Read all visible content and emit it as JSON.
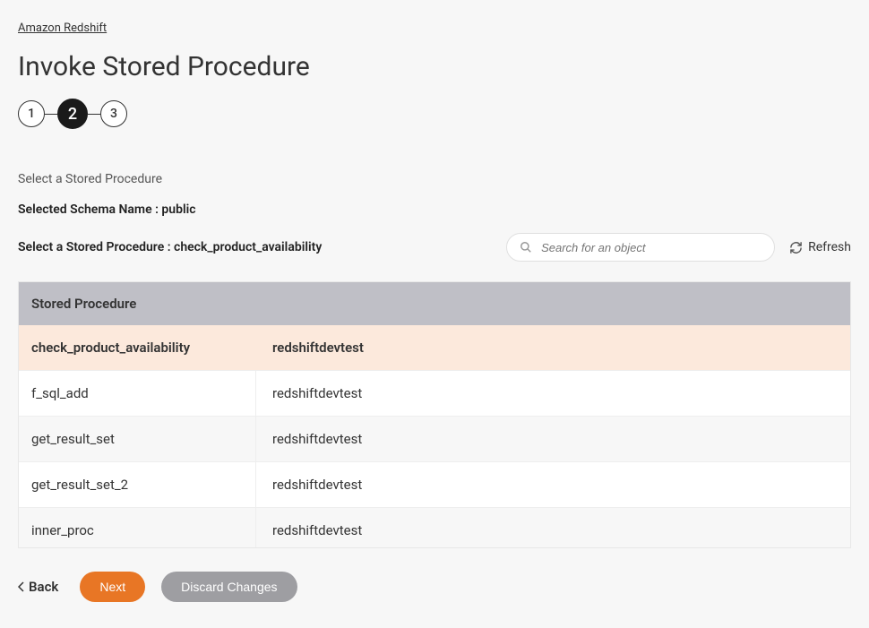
{
  "breadcrumb": "Amazon Redshift",
  "page_title": "Invoke Stored Procedure",
  "stepper": {
    "steps": [
      "1",
      "2",
      "3"
    ],
    "active_index": 1
  },
  "section_label": "Select a Stored Procedure",
  "schema_line": "Selected Schema Name : public",
  "selected_line": "Select a Stored Procedure : check_product_availability",
  "search": {
    "placeholder": "Search for an object"
  },
  "refresh_label": "Refresh",
  "table": {
    "header": "Stored Procedure",
    "rows": [
      {
        "name": "check_product_availability",
        "db": "redshiftdevtest",
        "selected": true,
        "alt": false
      },
      {
        "name": "f_sql_add",
        "db": "redshiftdevtest",
        "selected": false,
        "alt": false
      },
      {
        "name": "get_result_set",
        "db": "redshiftdevtest",
        "selected": false,
        "alt": true
      },
      {
        "name": "get_result_set_2",
        "db": "redshiftdevtest",
        "selected": false,
        "alt": false
      },
      {
        "name": "inner_proc",
        "db": "redshiftdevtest",
        "selected": false,
        "alt": true
      }
    ]
  },
  "footer": {
    "back": "Back",
    "next": "Next",
    "discard": "Discard Changes"
  }
}
